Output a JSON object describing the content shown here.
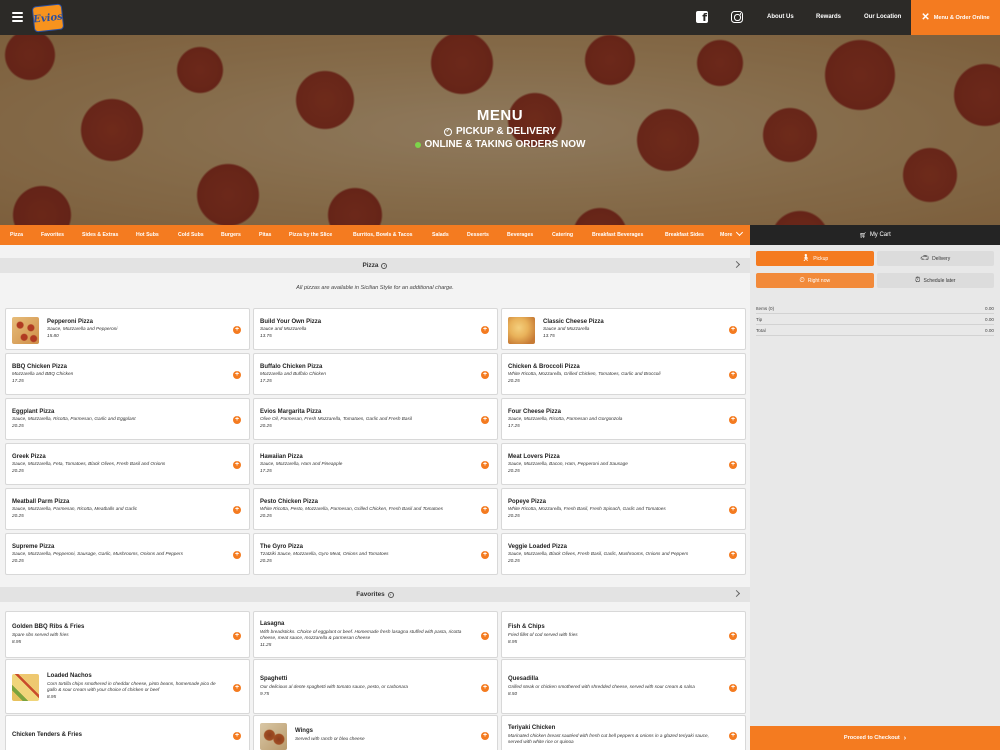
{
  "header": {
    "logo_text": "Evios",
    "nav": [
      "About Us",
      "Rewards",
      "Our Location"
    ],
    "order_button": "Menu & Order Online"
  },
  "hero": {
    "title": "MENU",
    "line1": "PICKUP & DELIVERY",
    "line2": "ONLINE & TAKING ORDERS NOW"
  },
  "categories": [
    "Pizza",
    "Favorites",
    "Sides & Extras",
    "Hot Subs",
    "Cold Subs",
    "Burgers",
    "Pitas",
    "Pizza by the Slice",
    "Burritos, Bowls & Tacos",
    "Salads",
    "Desserts",
    "Beverages",
    "Catering",
    "Breakfast Beverages",
    "Breakfast Sides",
    "More"
  ],
  "cart": {
    "title": "My Cart",
    "pickup": "Pickup",
    "delivery": "Delivery",
    "right_now": "Right now",
    "schedule": "Schedule later",
    "items_label": "Items (0)",
    "items_value": "0.00",
    "tip_label": "Tip",
    "tip_value": "0.00",
    "total_label": "Total",
    "total_value": "0.00",
    "checkout": "Proceed to Checkout"
  },
  "sections": [
    {
      "title": "Pizza",
      "note": "All pizzas are available in Sicilian Style for an additional charge.",
      "items": [
        {
          "name": "Pepperoni Pizza",
          "desc": "Sauce, Mozzarella and Pepperoni",
          "price": "15.80",
          "img": "pizza"
        },
        {
          "name": "Build Your Own Pizza",
          "desc": "Sauce and Mozzarella",
          "price": "13.75",
          "img": ""
        },
        {
          "name": "Classic Cheese Pizza",
          "desc": "Sauce and Mozzarella",
          "price": "13.75",
          "img": "cheese"
        },
        {
          "name": "BBQ Chicken Pizza",
          "desc": "Mozzarella and BBQ Chicken",
          "price": "17.25",
          "img": ""
        },
        {
          "name": "Buffalo Chicken Pizza",
          "desc": "Mozzarella and Buffalo Chicken",
          "price": "17.25",
          "img": ""
        },
        {
          "name": "Chicken & Broccoli Pizza",
          "desc": "White Ricotta, Mozzarella, Grilled Chicken, Tomatoes, Garlic and Broccoli",
          "price": "20.25",
          "img": ""
        },
        {
          "name": "Eggplant Pizza",
          "desc": "Sauce, Mozzarella, Ricotta, Parmesan, Garlic and Eggplant",
          "price": "20.25",
          "img": ""
        },
        {
          "name": "Evios Margarita Pizza",
          "desc": "Olive Oil, Parmesan, Fresh Mozzarella, Tomatoes, Garlic and Fresh Basil",
          "price": "20.25",
          "img": ""
        },
        {
          "name": "Four Cheese Pizza",
          "desc": "Sauce, Mozzarella, Ricotta, Parmesan and Gorgonzola",
          "price": "17.25",
          "img": ""
        },
        {
          "name": "Greek Pizza",
          "desc": "Sauce, Mozzarella, Feta, Tomatoes, Black Olives, Fresh Basil and Onions",
          "price": "20.25",
          "img": ""
        },
        {
          "name": "Hawaiian Pizza",
          "desc": "Sauce, Mozzarella, Ham and Pineapple",
          "price": "17.25",
          "img": ""
        },
        {
          "name": "Meat Lovers Pizza",
          "desc": "Sauce, Mozzarella, Bacon, Ham, Pepperoni and Sausage",
          "price": "20.25",
          "img": ""
        },
        {
          "name": "Meatball Parm Pizza",
          "desc": "Sauce, Mozzarella, Parmesan, Ricotta, Meatballs and Garlic",
          "price": "20.25",
          "img": ""
        },
        {
          "name": "Pesto Chicken Pizza",
          "desc": "White Ricotta, Pesto, Mozzarella, Parmesan, Grilled Chicken, Fresh Basil and Tomatoes",
          "price": "20.25",
          "img": ""
        },
        {
          "name": "Popeye Pizza",
          "desc": "White Ricotta, Mozzarella, Fresh Basil, Fresh Spinach, Garlic and Tomatoes",
          "price": "20.25",
          "img": ""
        },
        {
          "name": "Supreme Pizza",
          "desc": "Sauce, Mozzarella, Pepperoni, Sausage, Garlic, Mushrooms, Onions and Peppers",
          "price": "20.25",
          "img": ""
        },
        {
          "name": "The Gyro Pizza",
          "desc": "Tzatziki Sauce, Mozzarella, Gyro Meat, Onions and Tomatoes",
          "price": "20.25",
          "img": ""
        },
        {
          "name": "Veggie Loaded Pizza",
          "desc": "Sauce, Mozzarella, Black Olives, Fresh Basil, Garlic, Mushrooms, Onions and Peppers",
          "price": "20.25",
          "img": ""
        }
      ]
    },
    {
      "title": "Favorites",
      "note": "",
      "items": [
        {
          "name": "Golden BBQ Ribs & Fries",
          "desc": "Spare ribs served with fries",
          "price": "8.95",
          "img": ""
        },
        {
          "name": "Lasagna",
          "desc": "With breadsticks. Choice of eggplant or beef. Homemade fresh lasagna stuffed with pasta, ricotta cheese, meat sauce, mozzarella & parmesan cheese",
          "price": "11.25",
          "img": ""
        },
        {
          "name": "Fish & Chips",
          "desc": "Fried fillet of cod served with fries",
          "price": "8.95",
          "img": ""
        },
        {
          "name": "Loaded Nachos",
          "desc": "Corn tortilla chips smothered in cheddar cheese, pinto beans, homemade pico de gallo & sour cream with your choice of chicken or beef",
          "price": "8.95",
          "img": "nachos"
        },
        {
          "name": "Spaghetti",
          "desc": "Our delicious al dente spaghetti with tomato sauce, pesto, or carbonara",
          "price": "9.75",
          "img": ""
        },
        {
          "name": "Quesadilla",
          "desc": "Grilled steak or chicken smothered with shredded cheese, served with sour cream & salsa",
          "price": "8.50",
          "img": ""
        },
        {
          "name": "Chicken Tenders & Fries",
          "desc": "",
          "price": "",
          "img": ""
        },
        {
          "name": "Wings",
          "desc": "Served with ranch or bleu cheese",
          "price": "",
          "img": "wings"
        },
        {
          "name": "Teriyaki Chicken",
          "desc": "Marinated chicken breast sautéed with fresh cut bell peppers & onions in a glazed teriyaki sauce, served with white rice or quinoa",
          "price": "",
          "img": ""
        }
      ]
    }
  ]
}
